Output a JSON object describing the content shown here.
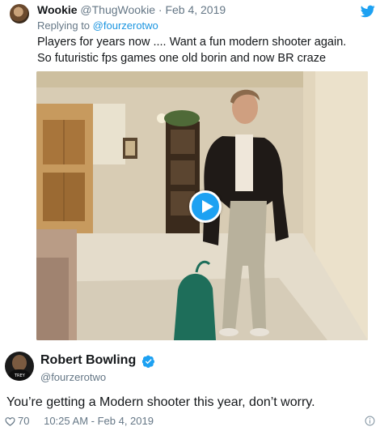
{
  "reply_tweet": {
    "author_name": "Wookie",
    "author_handle": "@ThugWookie",
    "separator": "·",
    "date": "Feb 4, 2019",
    "replying_to_prefix": "Replying to",
    "replying_to_handle": "@fourzerotwo",
    "text_line1": "Players for years now .... Want a fun modern shooter again.",
    "text_line2": "So futuristic fps games one old borin and now BR craze"
  },
  "media": {
    "type": "video",
    "play_icon": "play-icon"
  },
  "main_tweet": {
    "author_name": "Robert Bowling",
    "author_handle": "@fourzerotwo",
    "avatar_text": "TREY",
    "text": "You’re getting a Modern shooter this year, don’t worry.",
    "likes": "70",
    "time": "10:25 AM - Feb 4, 2019"
  },
  "icons": {
    "bird": "twitter-bird-icon",
    "verified": "verified-badge-icon",
    "heart": "heart-icon",
    "info": "info-icon"
  },
  "colors": {
    "link": "#1b95e0",
    "accent": "#1da1f2",
    "muted": "#657786",
    "text": "#14171a"
  }
}
